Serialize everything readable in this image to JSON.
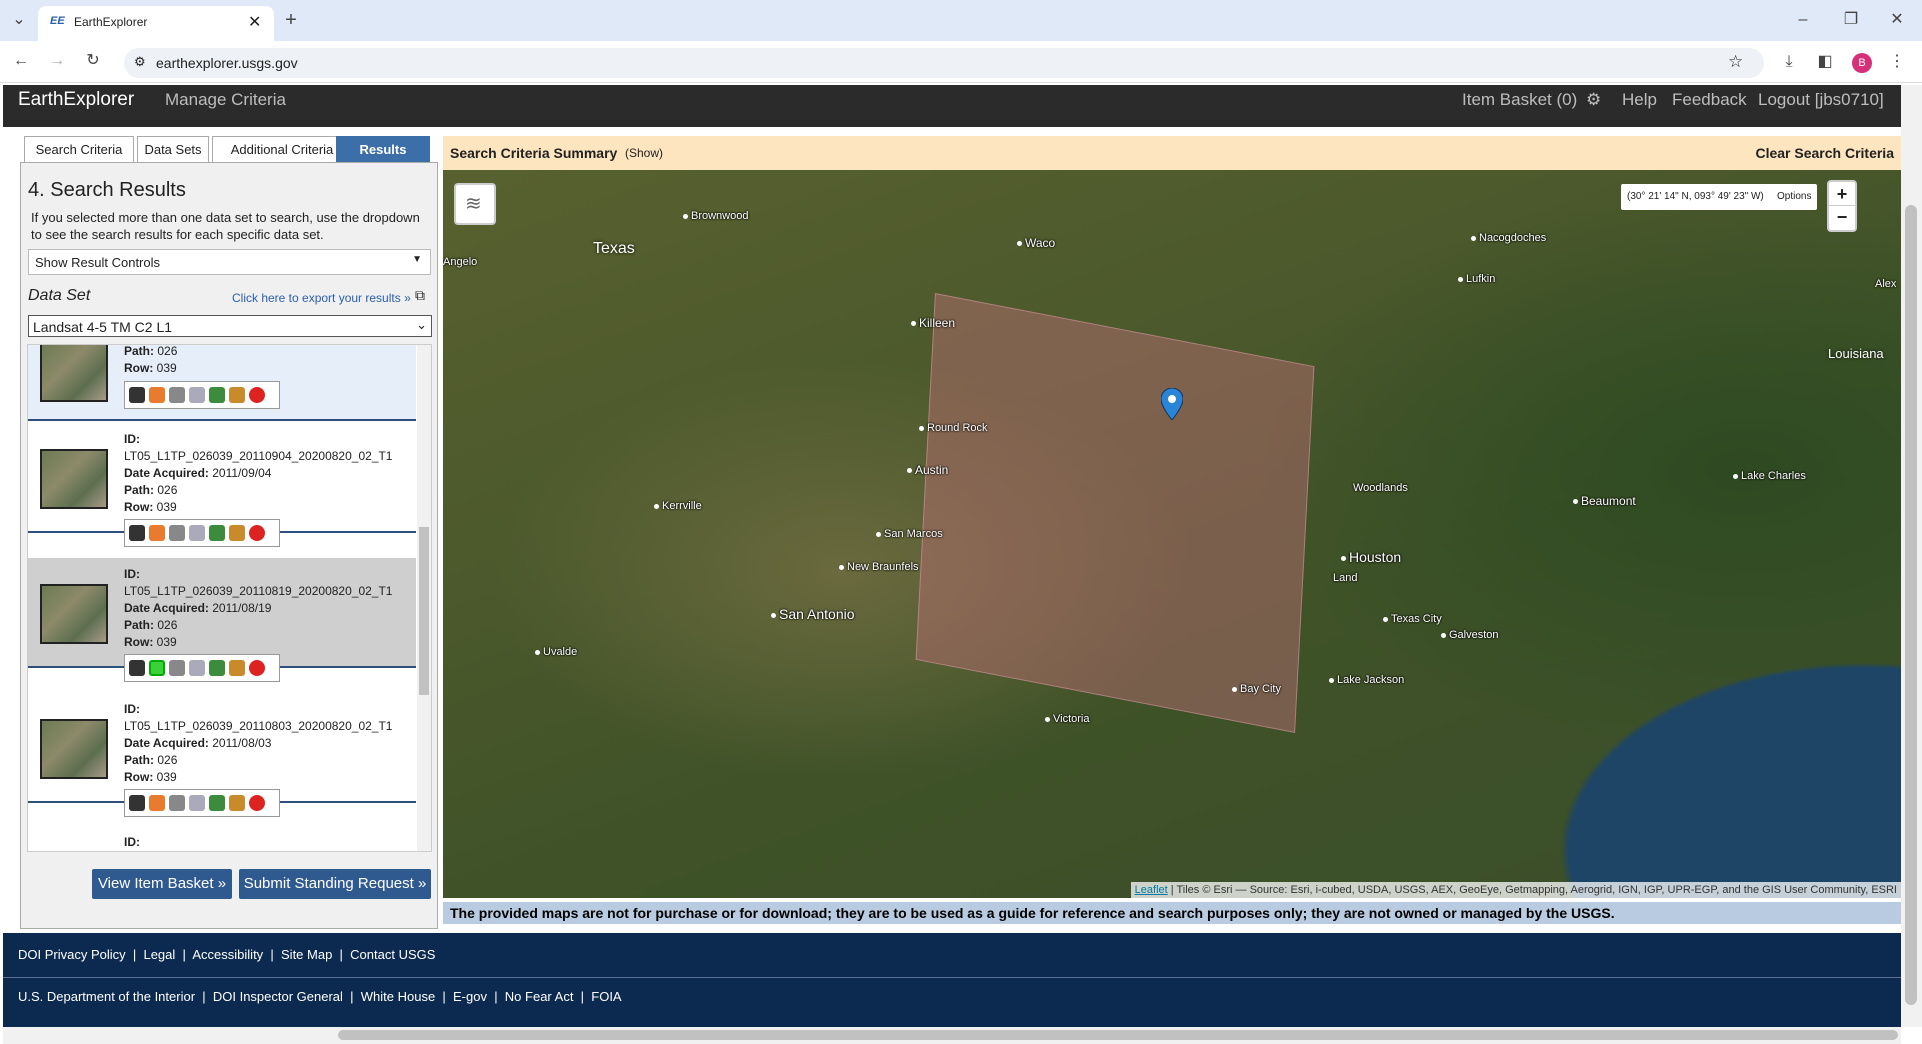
{
  "browser": {
    "tab_title": "EarthExplorer",
    "favicon_text": "EE",
    "url": "earthexplorer.usgs.gov",
    "profile_initial": "B"
  },
  "app": {
    "brand": "EarthExplorer",
    "manage_criteria": "Manage Criteria",
    "item_basket": "Item Basket (0)",
    "help": "Help",
    "feedback": "Feedback",
    "logout": "Logout [jbs0710]"
  },
  "tabs": [
    "Search Criteria",
    "Data Sets",
    "Additional Criteria",
    "Results"
  ],
  "results_panel": {
    "heading": "4. Search Results",
    "description": "If you selected more than one data set to search, use the dropdown to see the search results for each specific data set.",
    "show_controls": "Show Result Controls",
    "dataset_label": "Data Set",
    "export_link": "Click here to export your results »",
    "dataset_selected": "Landsat 4-5 TM C2 L1"
  },
  "results": [
    {
      "id": "",
      "date": "",
      "path": "026",
      "row": "039"
    },
    {
      "id": "LT05_L1TP_026039_20110904_20200820_02_T1",
      "date": "2011/09/04",
      "path": "026",
      "row": "039"
    },
    {
      "id": "LT05_L1TP_026039_20110819_20200820_02_T1",
      "date": "2011/08/19",
      "path": "026",
      "row": "039"
    },
    {
      "id": "LT05_L1TP_026039_20110803_20200820_02_T1",
      "date": "2011/08/03",
      "path": "026",
      "row": "039"
    }
  ],
  "labels": {
    "id": "ID:",
    "date": "Date Acquired:",
    "path": "Path:",
    "row": "Row:"
  },
  "buttons": {
    "view_basket": "View Item Basket »",
    "standing_request": "Submit Standing Request »"
  },
  "map": {
    "summary_title": "Search Criteria Summary",
    "summary_show": "(Show)",
    "clear": "Clear Search Criteria",
    "coords": "(30° 21' 14\" N, 093° 49' 23\" W)",
    "options": "Options",
    "zoom_in": "+",
    "zoom_out": "−",
    "attribution_link": "Leaflet",
    "attribution_text": " | Tiles © Esri — Source: Esri, i-cubed, USDA, USGS, AEX, GeoEye, Getmapping, Aerogrid, IGN, IGP, UPR-EGP, and the GIS User Community, ESRI",
    "disclaimer": "The provided maps are not for purchase or for download; they are to be used as a guide for reference and search purposes only; they are not owned or managed by the USGS.",
    "regions": [
      "Texas",
      "Louisiana"
    ],
    "cities": [
      "Brownwood",
      "Waco",
      "Nacogdoches",
      "Lufkin",
      "Killeen",
      "Round Rock",
      "Austin",
      "Kerrville",
      "San Marcos",
      "New Braunfels",
      "San Antonio",
      "Uvalde",
      "Woodlands",
      "Houston",
      "Land",
      "Texas City",
      "Galveston",
      "Beaumont",
      "Lake Charles",
      "Lake Jackson",
      "Bay City",
      "Victoria",
      "Angelo",
      "Alex"
    ]
  },
  "footer": {
    "row1": [
      "DOI Privacy Policy",
      "Legal",
      "Accessibility",
      "Site Map",
      "Contact USGS"
    ],
    "row2": [
      "U.S. Department of the Interior",
      "DOI Inspector General",
      "White House",
      "E-gov",
      "No Fear Act",
      "FOIA"
    ]
  }
}
